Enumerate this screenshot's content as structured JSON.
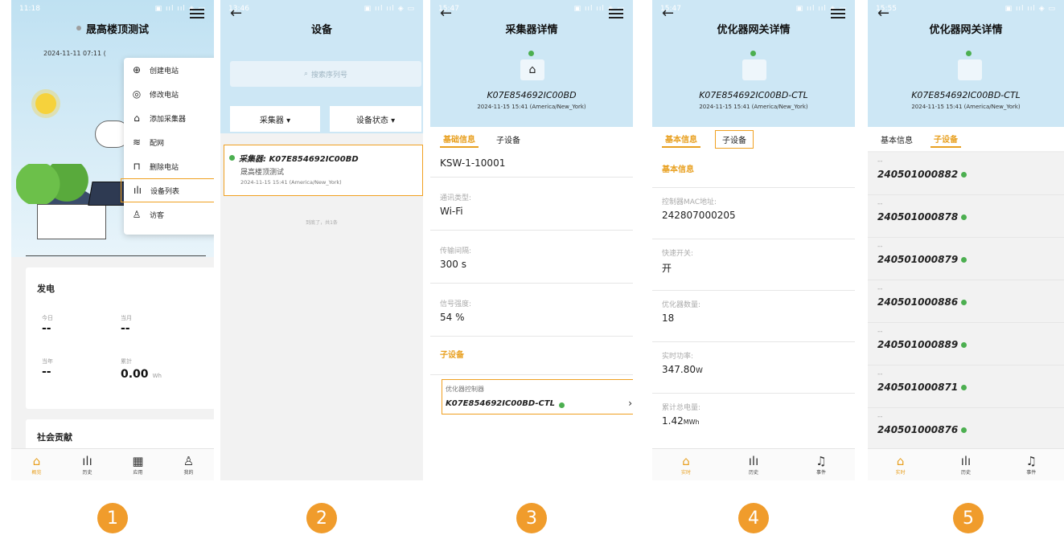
{
  "colors": {
    "accent": "#f09c2c",
    "online": "#4caf50",
    "header_blue": "#cde7f5"
  },
  "step_badges": [
    "1",
    "2",
    "3",
    "4",
    "5"
  ],
  "screen1": {
    "status_time": "11:18",
    "plant_name": "晟高楼顶测试",
    "datetime": "2024-11-11 07:11 (",
    "menu": [
      {
        "icon": "plus-circle-icon",
        "label": "创建电站"
      },
      {
        "icon": "settings-icon",
        "label": "修改电站"
      },
      {
        "icon": "router-icon",
        "label": "添加采集器"
      },
      {
        "icon": "wifi-icon",
        "label": "配网"
      },
      {
        "icon": "trash-icon",
        "label": "删除电站"
      },
      {
        "icon": "device-list-icon",
        "label": "设备列表"
      },
      {
        "icon": "user-icon",
        "label": "访客"
      }
    ],
    "power_card": {
      "title": "发电",
      "today_label": "今日",
      "today_value": "--",
      "month_label": "当月",
      "month_value": "--",
      "year_label": "当年",
      "year_value": "--",
      "total_label": "累計",
      "total_value": "0.00",
      "total_unit": "Wh"
    },
    "social_card_title": "社会贡献",
    "tabs": [
      {
        "icon": "home-icon",
        "label": "概览"
      },
      {
        "icon": "history-icon",
        "label": "历史"
      },
      {
        "icon": "apps-icon",
        "label": "应用"
      },
      {
        "icon": "user-icon",
        "label": "我的"
      }
    ]
  },
  "screen2": {
    "status_time": "13:46",
    "title": "设备",
    "search_placeholder": "搜索序列号",
    "filter_collector": "采集器 ▾",
    "filter_status": "设备状态 ▾",
    "item_title": "采集器: K07E854692IC00BD",
    "item_plant": "晟高楼顶测试",
    "item_time": "2024-11-15 15:41 (America/New_York)",
    "end_text": "到底了，共1条"
  },
  "screen3": {
    "status_time": "15:47",
    "title": "采集器详情",
    "serial": "K07E854692IC00BD",
    "time": "2024-11-15 15:41 (America/New_York)",
    "tab_basic": "基础信息",
    "tab_sub": "子设备",
    "model": "KSW-1-10001",
    "comm_label": "通讯类型:",
    "comm_value": "Wi-Fi",
    "interval_label": "传输间隔:",
    "interval_value": "300 s",
    "signal_label": "信号强度:",
    "signal_value": "54 %",
    "sub_section": "子设备",
    "sub_type": "优化器控制器",
    "sub_serial": "K07E854692IC00BD-CTL",
    "chevron": "›"
  },
  "screen4": {
    "status_time": "15:47",
    "title": "优化器网关详情",
    "serial": "K07E854692IC00BD-CTL",
    "time": "2024-11-15 15:41 (America/New_York)",
    "tab_basic": "基本信息",
    "tab_sub": "子设备",
    "section": "基本信息",
    "mac_label": "控制器MAC地址:",
    "mac_value": "242807000205",
    "rapid_label": "快速开关:",
    "rapid_value": "开",
    "count_label": "优化器数量:",
    "count_value": "18",
    "power_label": "实时功率:",
    "power_value": "347.80",
    "power_unit": "W",
    "energy_label": "累计总电量:",
    "energy_value": "1.42",
    "energy_unit": "MWh",
    "tabs": [
      {
        "icon": "home-icon",
        "label": "实时"
      },
      {
        "icon": "history-icon",
        "label": "历史"
      },
      {
        "icon": "bell-icon",
        "label": "事件"
      }
    ]
  },
  "screen5": {
    "status_time": "15:55",
    "title": "优化器网关详情",
    "serial": "K07E854692IC00BD-CTL",
    "time": "2024-11-15 15:41 (America/New_York)",
    "tab_basic": "基本信息",
    "tab_sub": "子设备",
    "optimizers": [
      {
        "name": "--",
        "serial": "240501000882"
      },
      {
        "name": "--",
        "serial": "240501000878"
      },
      {
        "name": "--",
        "serial": "240501000879"
      },
      {
        "name": "--",
        "serial": "240501000886"
      },
      {
        "name": "--",
        "serial": "240501000889"
      },
      {
        "name": "--",
        "serial": "240501000871"
      },
      {
        "name": "--",
        "serial": "240501000876"
      }
    ],
    "tabs": [
      {
        "icon": "home-icon",
        "label": "实时"
      },
      {
        "icon": "history-icon",
        "label": "历史"
      },
      {
        "icon": "bell-icon",
        "label": "事件"
      }
    ]
  }
}
